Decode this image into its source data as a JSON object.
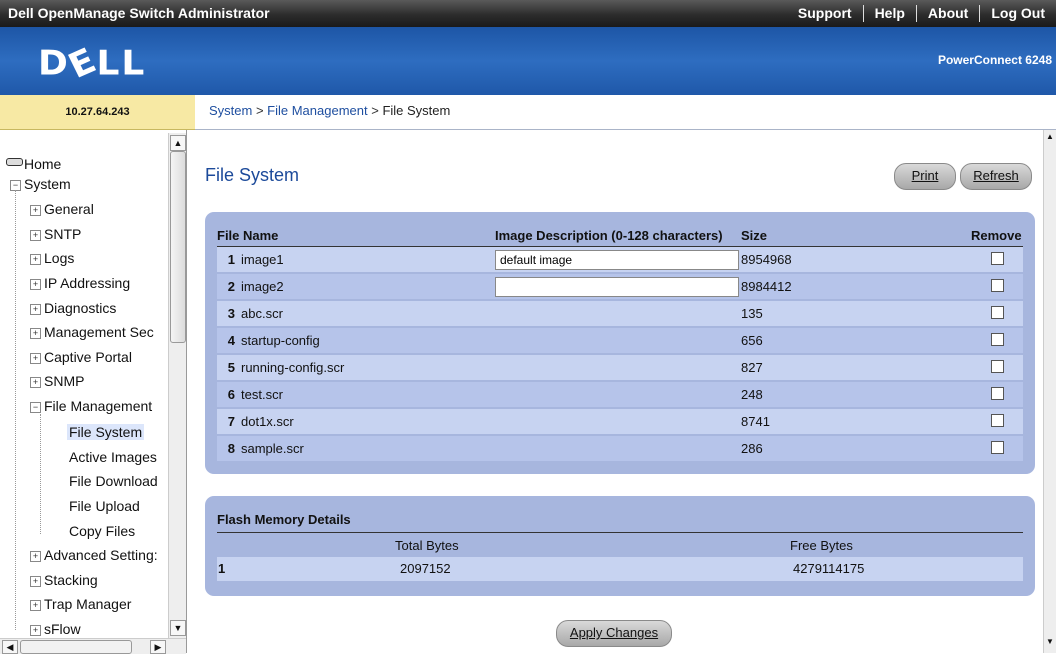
{
  "app": {
    "title": "Dell OpenManage Switch Administrator"
  },
  "topnav": {
    "support": "Support",
    "help": "Help",
    "about": "About",
    "logout": "Log Out"
  },
  "header": {
    "logo": "DELL",
    "product": "PowerConnect 6248"
  },
  "device": {
    "ip": "10.27.64.243"
  },
  "breadcrumb": {
    "part1": "System",
    "sep1": " > ",
    "part2": "File Management",
    "sep2": " > ",
    "part3": "File System"
  },
  "sidebar": {
    "home": "Home",
    "system": "System",
    "general": "General",
    "sntp": "SNTP",
    "logs": "Logs",
    "ip_addressing": "IP Addressing",
    "diagnostics": "Diagnostics",
    "management_sec": "Management Sec",
    "captive_portal": "Captive Portal",
    "snmp": "SNMP",
    "file_management": "File Management",
    "file_system": "File System",
    "active_images": "Active Images",
    "file_download": "File Download",
    "file_upload": "File Upload",
    "copy_files": "Copy Files",
    "advanced_settings": "Advanced Setting:",
    "stacking": "Stacking",
    "trap_manager": "Trap Manager",
    "sflow": "sFlow"
  },
  "page": {
    "title": "File System",
    "print": "Print",
    "refresh": "Refresh",
    "apply": "Apply Changes"
  },
  "files_table": {
    "headers": {
      "file_name": "File Name",
      "description": "Image Description (0-128 characters)",
      "size": "Size",
      "remove": "Remove"
    },
    "rows": [
      {
        "num": "1",
        "name": "image1",
        "description": "default image",
        "size": "8954968"
      },
      {
        "num": "2",
        "name": "image2",
        "description": "",
        "size": "8984412"
      },
      {
        "num": "3",
        "name": "abc.scr",
        "size": "135"
      },
      {
        "num": "4",
        "name": "startup-config",
        "size": "656"
      },
      {
        "num": "5",
        "name": "running-config.scr",
        "size": "827"
      },
      {
        "num": "6",
        "name": "test.scr",
        "size": "248"
      },
      {
        "num": "7",
        "name": "dot1x.scr",
        "size": "8741"
      },
      {
        "num": "8",
        "name": "sample.scr",
        "size": "286"
      }
    ]
  },
  "flash": {
    "title": "Flash Memory Details",
    "total_label": "Total Bytes",
    "free_label": "Free Bytes",
    "row_num": "1",
    "total": "2097152",
    "free": "4279114175"
  }
}
